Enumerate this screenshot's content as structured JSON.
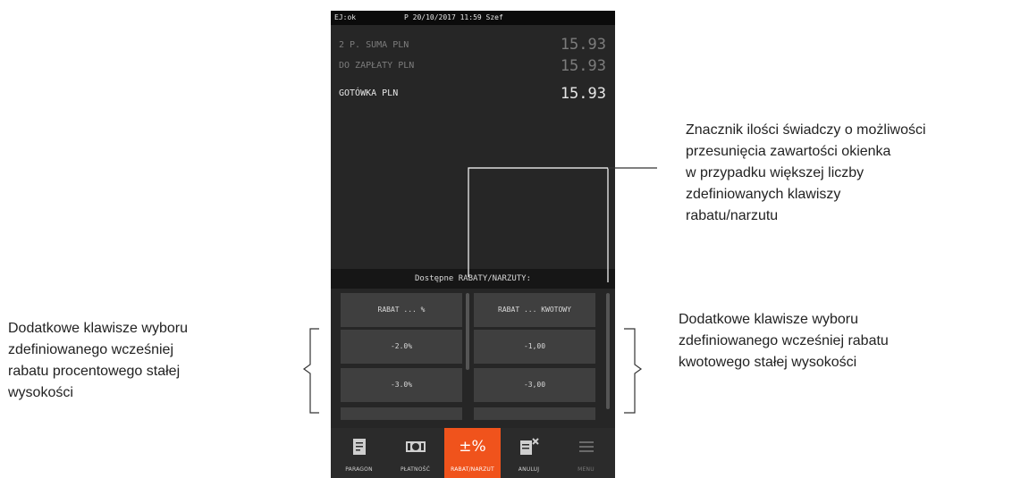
{
  "status_bar": {
    "left": "EJ:ok",
    "center": "P 20/10/2017 11:59 Szef"
  },
  "summary": [
    {
      "label": "2 P. SUMA PLN",
      "value": "15.93"
    },
    {
      "label": "DO ZAPŁATY PLN",
      "value": "15.93"
    },
    {
      "label": "GOTÓWKA PLN",
      "value": "15.93"
    }
  ],
  "discounts_header": "Dostępne RABATY/NARZUTY:",
  "discount_columns": [
    {
      "header": "RABAT ... %",
      "items": [
        "-2.0%",
        "-3.0%"
      ]
    },
    {
      "header": "RABAT ... KWOTOWY",
      "items": [
        "-1,00",
        "-3,00"
      ]
    }
  ],
  "toolbar": [
    {
      "label": "PARAGON",
      "icon": "receipt-icon",
      "active": false
    },
    {
      "label": "PŁATNOŚĆ",
      "icon": "cash-icon",
      "active": false
    },
    {
      "label": "RABAT/NARZUT",
      "icon": "plus-minus-percent-icon",
      "glyph": "±%",
      "active": true
    },
    {
      "label": "ANULUJ",
      "icon": "cancel-receipt-icon",
      "active": false
    },
    {
      "label": "MENU",
      "icon": "menu-icon",
      "active": false
    }
  ],
  "annotations": {
    "top_right": [
      "Znacznik ilości świadczy o możliwości",
      "przesunięcia zawartości okienka",
      "w przypadku większej liczby",
      "zdefiniowanych klawiszy",
      "rabatu/narzutu"
    ],
    "left": [
      "Dodatkowe klawisze wyboru",
      "zdefiniowanego wcześniej",
      "rabatu procentowego stałej",
      "wysokości"
    ],
    "right": [
      "Dodatkowe klawisze wyboru",
      "zdefiniowanego wcześniej rabatu",
      "kwotowego stałej wysokości"
    ]
  },
  "colors": {
    "accent": "#f0531c",
    "screen_bg": "#262626",
    "key_bg": "#3f3f3f"
  }
}
